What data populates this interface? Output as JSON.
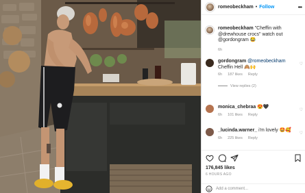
{
  "post": {
    "username": "romeobeckham",
    "separator": "•",
    "follow_label": "Follow",
    "more_icon": "ellipsis-icon"
  },
  "caption": {
    "username": "romeobeckham",
    "text": " \"Cheffin with @drewhouse crocs\" watch out @gordongram 😂",
    "time": "6h"
  },
  "comments": [
    {
      "username": "gordongram",
      "mention": " @romeobeckham",
      "text": " Cheffin Hell 🙈🙌",
      "time": "6h",
      "likes": "187 likes",
      "reply": "Reply",
      "view_replies": "View replies (2)",
      "avatar_color": "#3a2a1e"
    },
    {
      "username": "monica_chebraa",
      "text": " 😍🖤",
      "time": "6h",
      "likes": "101 likes",
      "reply": "Reply",
      "avatar_color": "#b5734f"
    },
    {
      "username": "_lucinda.warner_",
      "text": " i'm lovely 🤩🥰",
      "time": "6h",
      "likes": "225 likes",
      "reply": "Reply",
      "avatar_color": "#7d5a4a"
    }
  ],
  "footer": {
    "likes": "176,845 likes",
    "time_ago": "6 HOURS AGO",
    "add_comment_placeholder": "Add a comment..."
  },
  "colors": {
    "accent": "#0095f6",
    "muted": "#8e8e8e",
    "text": "#262626"
  }
}
